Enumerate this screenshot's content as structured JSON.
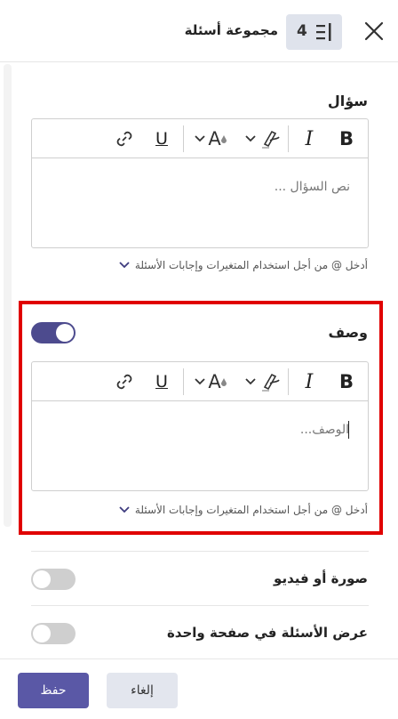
{
  "header": {
    "title": "مجموعة أسئلة",
    "badge_count": "4",
    "close_icon": "close-icon",
    "list_icon": "list-icon"
  },
  "question": {
    "label": "سؤال",
    "placeholder": "نص السؤال ...",
    "hint": "أدخل @ من أجل استخدام المتغيرات وإجابات الأسئلة"
  },
  "description": {
    "label": "وصف",
    "placeholder": "الوصف...",
    "hint": "أدخل @ من أجل استخدام المتغيرات وإجابات الأسئلة",
    "toggle_on": true
  },
  "toolbar": {
    "bold": "B",
    "italic": "I",
    "underline": "U",
    "font_color": "A"
  },
  "options": [
    {
      "label": "صورة أو فيديو",
      "toggle_on": false
    },
    {
      "label": "عرض الأسئلة في صفحة واحدة",
      "toggle_on": false
    }
  ],
  "footer": {
    "save_label": "حفظ",
    "cancel_label": "إلغاء"
  },
  "colors": {
    "accent": "#5a58a6",
    "toggle_on": "#4d4b8e",
    "highlight": "#e00000"
  }
}
